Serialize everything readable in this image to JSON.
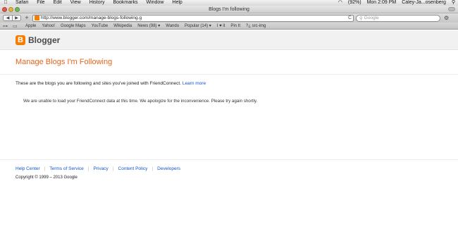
{
  "menubar": {
    "apple_icon": "",
    "items": [
      "Safari",
      "File",
      "Edit",
      "View",
      "History",
      "Bookmarks",
      "Window",
      "Help"
    ],
    "battery": "(92%)",
    "clock": "Mon 2:09 PM",
    "user": "Caley-Ja...osenberg"
  },
  "window": {
    "title": "Blogs I'm following"
  },
  "toolbar": {
    "url": "http://www.blogger.com/manage-blogs-following.g",
    "search_placeholder": "Google",
    "back_glyph": "◀",
    "forward_glyph": "▶",
    "add_glyph": "+",
    "reload_glyph": "C"
  },
  "bookmarks": {
    "items": [
      "Apple",
      "Yahoo!",
      "Google Maps",
      "YouTube",
      "Wikipedia",
      "News (98) ▾",
      "Wando",
      "Popular (14) ▾",
      "I ♥ it",
      "Pin It",
      "?¿ src-img"
    ]
  },
  "page": {
    "logo_text": "Blogger",
    "logo_letter": "B",
    "heading": "Manage Blogs I'm Following",
    "intro_text": "These are the blogs you are following and sites you've joined with FriendConnect.",
    "learn_more": "Learn more",
    "error_text": "We are unable to load your FriendConnect data at this time. We apologize for the inconvenience. Please try again shortly."
  },
  "footer": {
    "links": [
      "Help Center",
      "Terms of Service",
      "Privacy",
      "Content Policy",
      "Developers"
    ],
    "copyright": "Copyright © 1999 – 2013 Google"
  },
  "colors": {
    "accent_orange": "#e8641b",
    "link_blue": "#1155cc",
    "blogger_orange": "#f57d00"
  }
}
